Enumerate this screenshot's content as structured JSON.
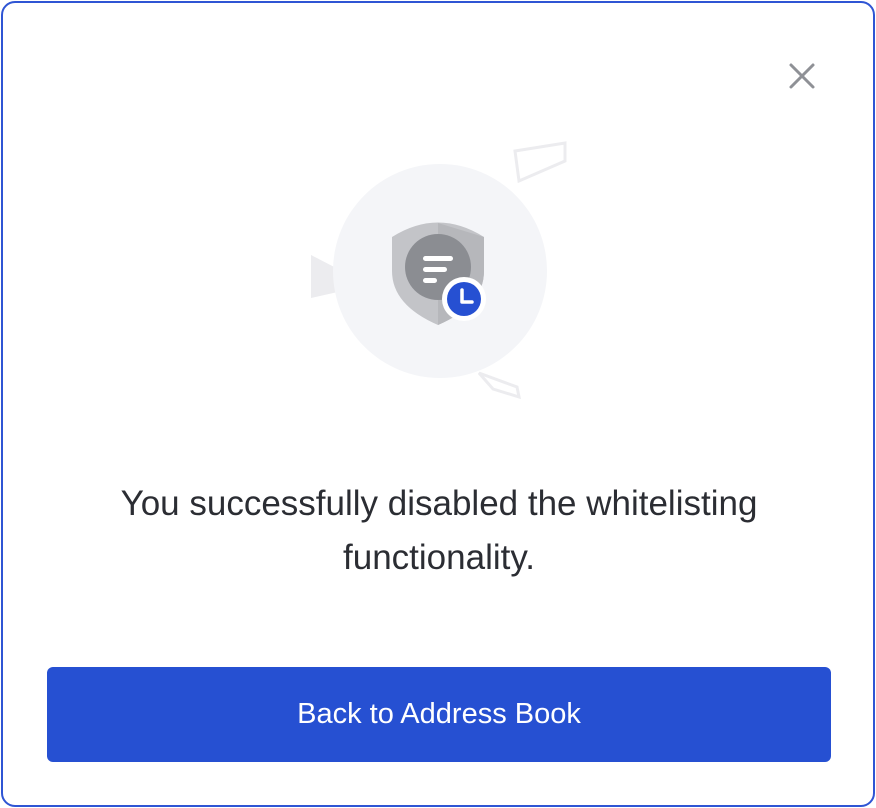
{
  "dialog": {
    "message": "You successfully disabled the whitelisting functionality.",
    "primary_button_label": "Back to Address Book",
    "close_icon": "close-icon",
    "illustration_icons": [
      "shield-icon",
      "document-lines-icon",
      "clock-icon"
    ]
  },
  "colors": {
    "accent": "#2650d2",
    "border": "#2f55d4",
    "text": "#2b2d33",
    "icon_gray": "#8f9196",
    "illustration_bg": "#f4f5f8"
  }
}
